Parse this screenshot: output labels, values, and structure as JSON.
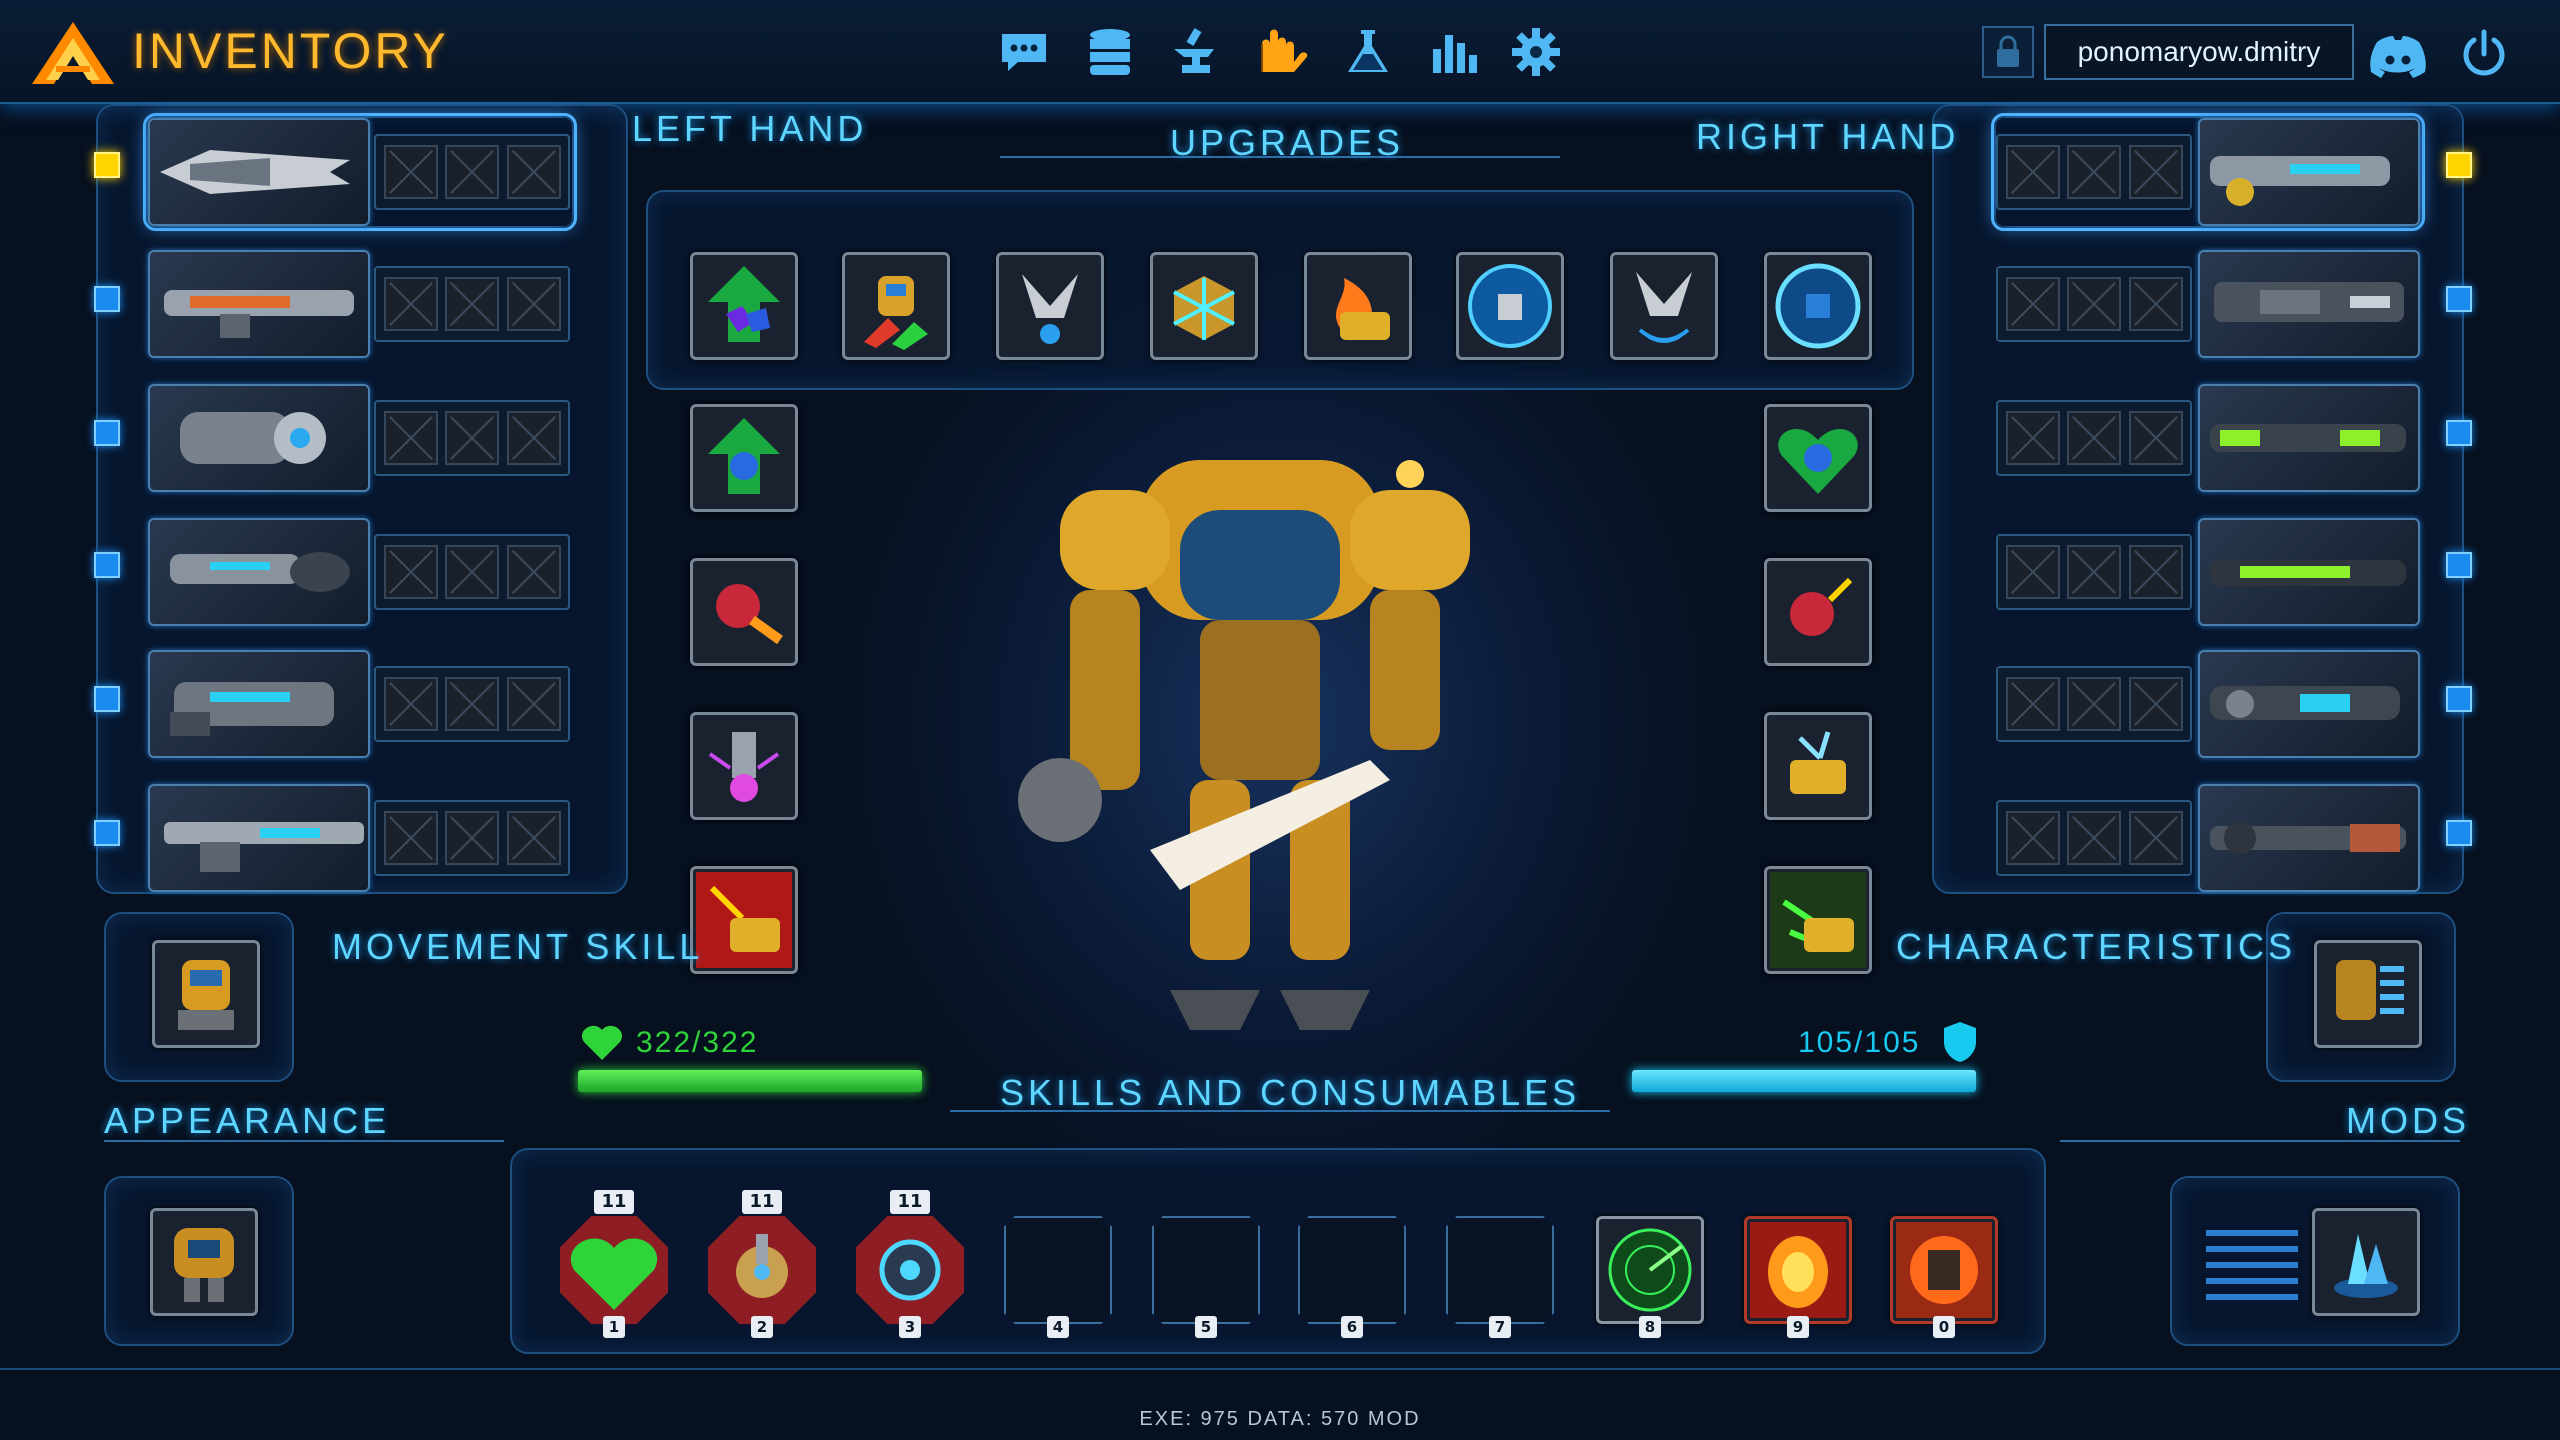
{
  "header": {
    "title": "INVENTORY",
    "username": "ponomaryow.dmitry"
  },
  "nav": [
    {
      "icon": "chat-icon"
    },
    {
      "icon": "database-icon"
    },
    {
      "icon": "anvil-icon"
    },
    {
      "icon": "mech-hands-icon",
      "active": true
    },
    {
      "icon": "flask-icon"
    },
    {
      "icon": "stats-icon"
    },
    {
      "icon": "gear-icon"
    }
  ],
  "sections": {
    "left_hand": "LEFT HAND",
    "upgrades": "UPGRADES",
    "right_hand": "RIGHT HAND",
    "movement_skill": "MOVEMENT SKILL",
    "characteristics": "CHARACTERISTICS",
    "appearance": "APPEARANCE",
    "mods": "MODS",
    "skills": "SKILLS AND CONSUMABLES"
  },
  "stats": {
    "health": "322/322",
    "health_fraction": 1.0,
    "shield": "105/105",
    "shield_fraction": 1.0
  },
  "skills": [
    {
      "key": "1",
      "count": "11",
      "kind": "heart"
    },
    {
      "key": "2",
      "count": "11",
      "kind": "turret"
    },
    {
      "key": "3",
      "count": "11",
      "kind": "orb"
    },
    {
      "key": "4"
    },
    {
      "key": "5"
    },
    {
      "key": "6"
    },
    {
      "key": "7"
    },
    {
      "key": "8",
      "kind": "radar"
    },
    {
      "key": "9",
      "kind": "fire"
    },
    {
      "key": "0",
      "kind": "blast"
    }
  ],
  "footer": "EXE: 975  DATA: 570  MOD",
  "colors": {
    "accent": "#5fd6ff",
    "title": "#ffb92e",
    "health": "#2fd33a",
    "shield": "#18c9f0",
    "selected": "#ffd400"
  }
}
